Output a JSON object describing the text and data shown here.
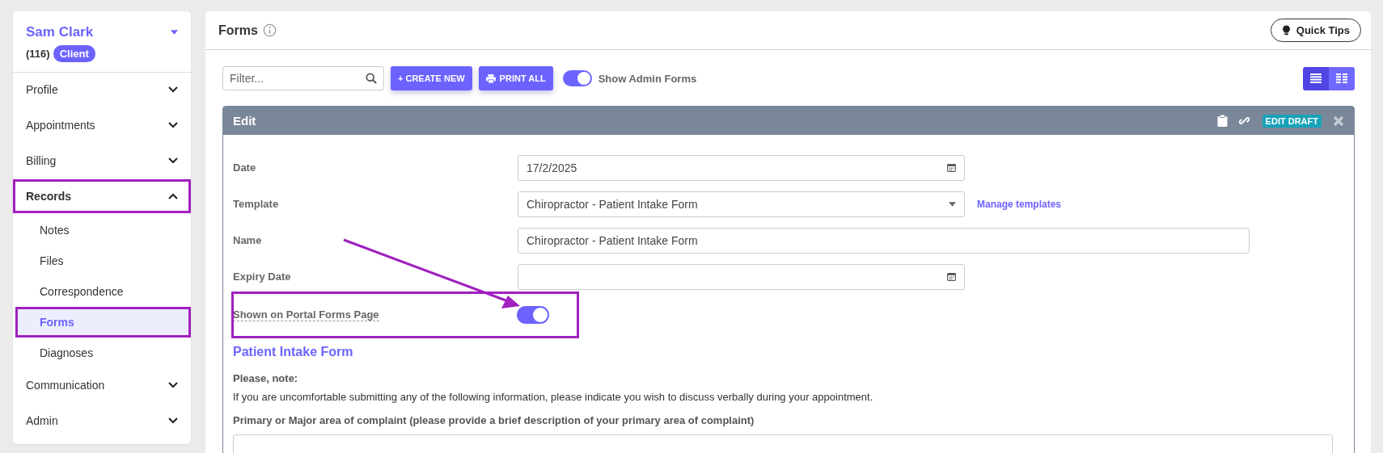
{
  "client": {
    "name": "Sam Clark",
    "count": "(116)",
    "badge": "Client"
  },
  "sidebar": {
    "items": [
      {
        "label": "Profile",
        "expanded": false,
        "annotated": false
      },
      {
        "label": "Appointments",
        "expanded": false,
        "annotated": false
      },
      {
        "label": "Billing",
        "expanded": false,
        "annotated": false
      },
      {
        "label": "Records",
        "expanded": true,
        "annotated": true,
        "children": [
          {
            "label": "Notes",
            "selected": false,
            "annotated": false
          },
          {
            "label": "Files",
            "selected": false,
            "annotated": false
          },
          {
            "label": "Correspondence",
            "selected": false,
            "annotated": false
          },
          {
            "label": "Forms",
            "selected": true,
            "annotated": true
          },
          {
            "label": "Diagnoses",
            "selected": false,
            "annotated": false
          }
        ]
      },
      {
        "label": "Communication",
        "expanded": false,
        "annotated": false
      },
      {
        "label": "Admin",
        "expanded": false,
        "annotated": false
      }
    ]
  },
  "page": {
    "title": "Forms",
    "quick_tips": "Quick Tips"
  },
  "toolbar": {
    "filter": {
      "placeholder": "Filter..."
    },
    "create": "+ CREATE NEW",
    "print": "PRINT ALL",
    "admin_toggle": {
      "label": "Show Admin Forms",
      "on": true
    },
    "views": [
      {
        "kind": "list",
        "selected": true
      },
      {
        "kind": "grid",
        "selected": false
      }
    ]
  },
  "edit": {
    "title": "Edit",
    "badge": "EDIT DRAFT",
    "fields": [
      {
        "kind": "date",
        "label": "Date",
        "value": "17/2/2025"
      },
      {
        "kind": "select",
        "label": "Template",
        "value": "Chiropractor - Patient Intake Form",
        "link": "Manage templates"
      },
      {
        "kind": "text",
        "label": "Name",
        "value": "Chiropractor - Patient Intake Form"
      },
      {
        "kind": "date",
        "label": "Expiry Date"
      },
      {
        "kind": "toggle",
        "label": "Shown on Portal Forms Page",
        "on": true,
        "annotated": true
      }
    ],
    "form_title": "Patient Intake Form",
    "note_title": "Please, note:",
    "note": "If you are uncomfortable submitting any of the following information, please indicate you wish to discuss verbally during your appointment.",
    "question": "Primary or Major area of complaint (please provide a brief description of your primary area of complaint)"
  }
}
